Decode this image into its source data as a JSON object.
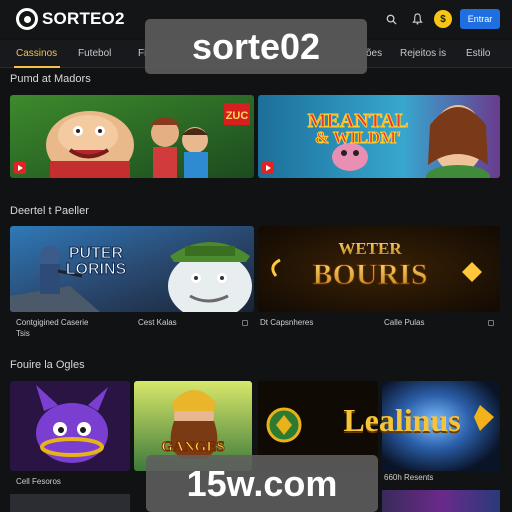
{
  "header": {
    "logo_text": "SORTEO2",
    "login_label": "Entrar",
    "coin_symbol": "$"
  },
  "nav": {
    "items": [
      {
        "label": "Cassinos",
        "active": true
      },
      {
        "label": "Futebol",
        "active": false
      },
      {
        "label": "Fi",
        "active": false
      },
      {
        "label": "ões",
        "active": false
      },
      {
        "label": "Rejeitos is",
        "active": false
      },
      {
        "label": "Estilo",
        "active": false
      }
    ]
  },
  "watermarks": {
    "top": "sorte02",
    "bottom": "15w.com"
  },
  "sections": [
    {
      "title": "Pumd at Madors"
    },
    {
      "title": "Deertel t Paeller"
    },
    {
      "title": "Fouire la Ogles"
    }
  ],
  "row1": {
    "card1_badge": "ZUC",
    "card2_title_line1": "MEANTAL",
    "card2_title_line2": "& WILDM'"
  },
  "row2": {
    "card1_title_line1": "PUTER",
    "card1_title_line2": "LORINS",
    "card2_title_line1": "WETER",
    "card2_title_line2": "BOURIS",
    "labels": [
      "Contgigined Caserie",
      "Cest Kalas",
      "Dt Capsnheres",
      "Calle Pulas"
    ],
    "sub_label": "Tsis"
  },
  "row3": {
    "card2_title": "GANGES",
    "card3_title": "Lealinus",
    "labels": [
      "Cell Fesoros",
      "660h Resents"
    ]
  },
  "colors": {
    "accent": "#f3c14b",
    "brand_blue": "#1f6fe0",
    "badge_red": "#e02424",
    "bg": "#111214"
  }
}
